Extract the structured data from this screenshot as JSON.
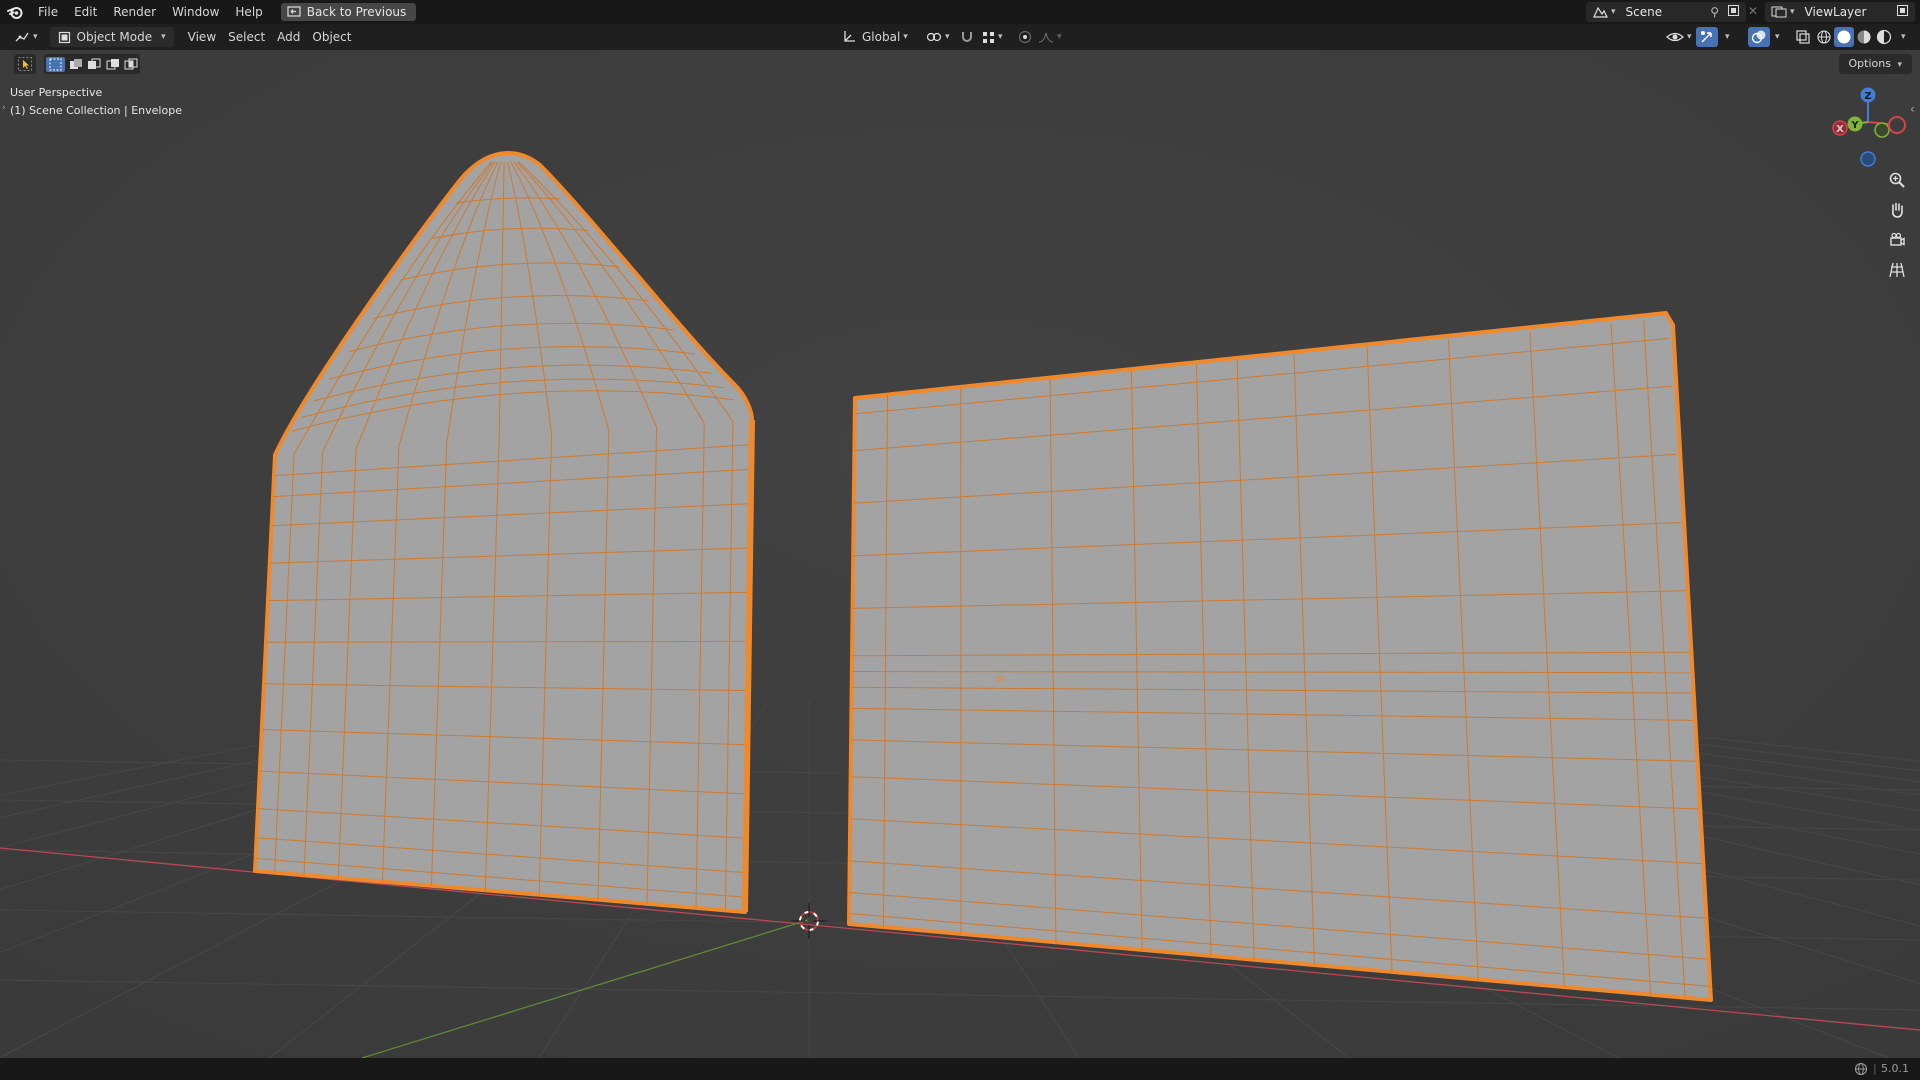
{
  "menubar": {
    "items": [
      "File",
      "Edit",
      "Render",
      "Window",
      "Help"
    ],
    "back_label": "Back to Previous",
    "scene_name": "Scene",
    "view_layer_name": "ViewLayer"
  },
  "header": {
    "mode_label": "Object Mode",
    "menus": [
      "View",
      "Select",
      "Add",
      "Object"
    ],
    "transform_orientation": "Global"
  },
  "toolsettings": {
    "options_label": "Options"
  },
  "viewport": {
    "perspective_label": "User Perspective",
    "collection_label": "(1) Scene Collection | Envelope",
    "gizmo": {
      "z": "Z",
      "y": "Y",
      "x": "X"
    }
  },
  "statusbar": {
    "version": "5.0.1"
  },
  "colors": {
    "select_outline": "#f0892b",
    "mesh_fill": "#9e9e9e",
    "wire": "#d07a2c",
    "axis_x": "#c24a55",
    "axis_y": "#6b9a3a",
    "gizmo_z": "#3f7fd6",
    "gizmo_y": "#7fb63a",
    "gizmo_x": "#d8404a"
  }
}
